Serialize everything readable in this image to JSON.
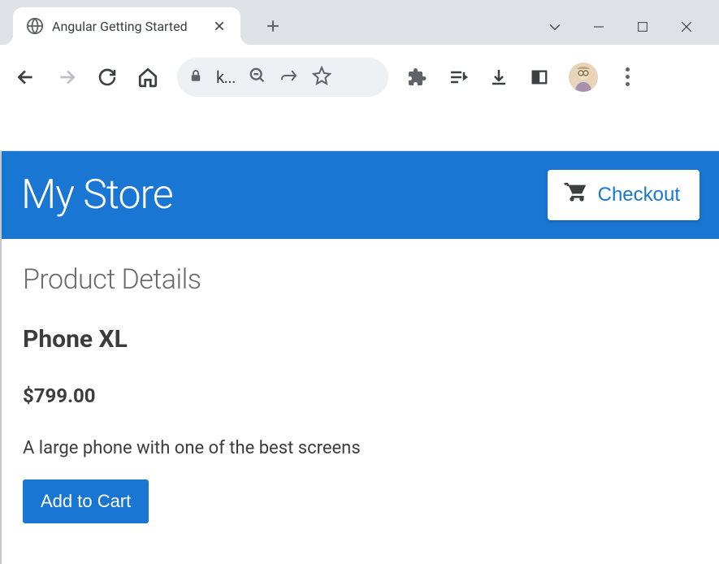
{
  "browser": {
    "tab_title": "Angular Getting Started",
    "url_display": "k..."
  },
  "app": {
    "title": "My Store",
    "checkout_label": "Checkout"
  },
  "product": {
    "section_title": "Product Details",
    "name": "Phone XL",
    "price": "$799.00",
    "description": "A large phone with one of the best screens",
    "add_to_cart_label": "Add to Cart"
  }
}
